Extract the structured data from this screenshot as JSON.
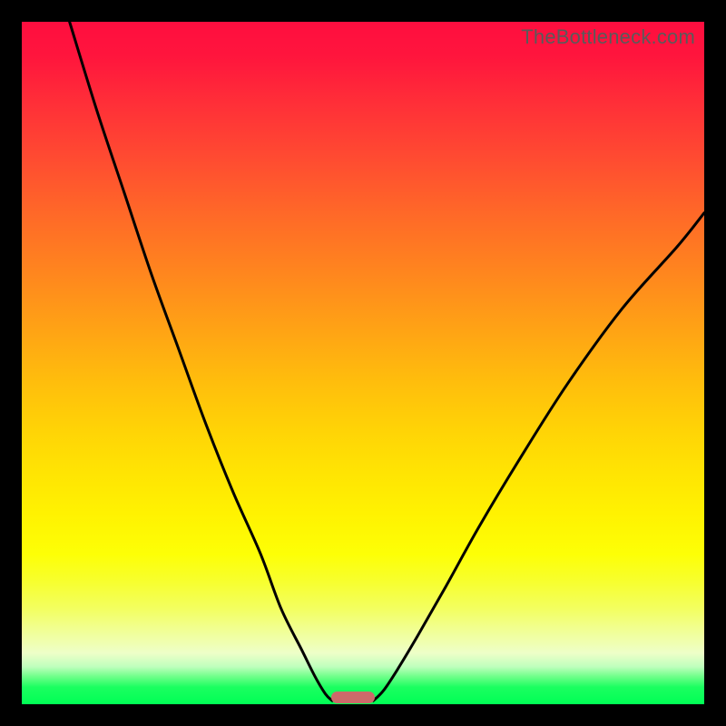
{
  "watermark": "TheBottleneck.com",
  "chart_data": {
    "type": "line",
    "title": "",
    "xlabel": "",
    "ylabel": "",
    "xlim": [
      0,
      100
    ],
    "ylim": [
      0,
      100
    ],
    "grid": false,
    "legend": false,
    "background_gradient": {
      "direction": "vertical",
      "stops": [
        {
          "pos": 0.0,
          "color": "#ff0e3f"
        },
        {
          "pos": 0.3,
          "color": "#ff6828"
        },
        {
          "pos": 0.55,
          "color": "#ffc80a"
        },
        {
          "pos": 0.75,
          "color": "#fbff08"
        },
        {
          "pos": 0.92,
          "color": "#eeffc8"
        },
        {
          "pos": 1.0,
          "color": "#00ff55"
        }
      ]
    },
    "series": [
      {
        "name": "left-curve",
        "x": [
          7,
          11,
          15,
          19,
          23,
          27,
          31,
          35,
          38,
          41,
          43,
          44.5,
          45.5
        ],
        "y": [
          100,
          87,
          75,
          63,
          52,
          41,
          31,
          22,
          14,
          8,
          4,
          1.5,
          0.5
        ]
      },
      {
        "name": "right-curve",
        "x": [
          51.5,
          53,
          55,
          58,
          62,
          67,
          73,
          80,
          88,
          96,
          100
        ],
        "y": [
          0.5,
          2,
          5,
          10,
          17,
          26,
          36,
          47,
          58,
          67,
          72
        ]
      }
    ],
    "marker": {
      "shape": "rounded-rect",
      "color": "#cc6a6a",
      "x_center": 48.5,
      "y_center": 1.0,
      "width_pct": 6.4,
      "height_pct": 1.8
    }
  }
}
